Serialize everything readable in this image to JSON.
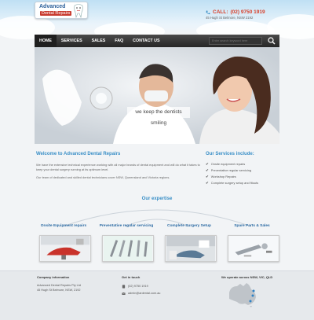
{
  "brand": {
    "line1": "Advanced",
    "line2": "Dental Repairs"
  },
  "contact": {
    "call_label": "CALL:",
    "phone": "(02) 9750 1919",
    "address": "45 Hugh St Belmore, NSW 2192"
  },
  "nav": {
    "items": [
      "HOME",
      "SERVICES",
      "SALES",
      "FAQ",
      "CONTACT US"
    ],
    "search_placeholder": "Enter search keyword here"
  },
  "hero": {
    "tagline": "we keep the dentists smiling"
  },
  "welcome": {
    "title": "Welcome to Advanced Dental Repairs",
    "p1": "We have the extensive technical experience working with all major brands of dental equipment and will do what it takes to keep your dental surgery running at its optimum level.",
    "p2": "Our team of dedicated and skilled dental technicians cover NSW, Queensland and Victoria regions."
  },
  "services": {
    "title": "Our Services include:",
    "items": [
      "Onsite equipment repairs",
      "Preventative regular servicing",
      "Workshop Repairs",
      "Complete surgery setup and fitouts"
    ]
  },
  "expertise": {
    "title": "Our expertise",
    "cards": [
      {
        "title": "Onsite Equipment repairs"
      },
      {
        "title": "Preventative regular servicing"
      },
      {
        "title": "Complete Surgery Setup"
      },
      {
        "title": "Spare Parts & Sales"
      }
    ]
  },
  "footer": {
    "company": {
      "heading": "Company information",
      "name": "Advanced Dental Repairs Pty Ltd",
      "address": "45 Hugh St Belmore, NSW, 2192"
    },
    "touch": {
      "heading": "Get in touch",
      "phone": "(02) 9750 1919",
      "email": "admin@ardental.com.au"
    },
    "operate": {
      "heading": "We operate across NSW, VIC, QLD"
    }
  },
  "colors": {
    "accent_blue": "#3a8fc7",
    "phone_red": "#d9402a",
    "nav_dark": "#2a2a2a"
  }
}
